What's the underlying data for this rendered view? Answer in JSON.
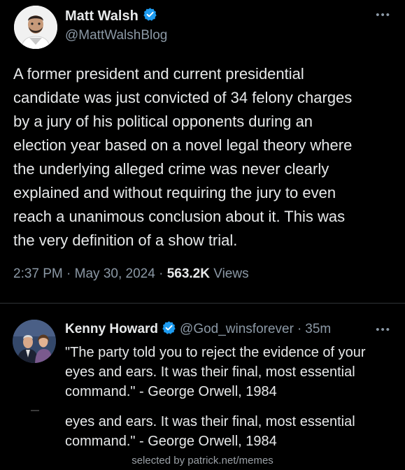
{
  "main_tweet": {
    "author_name": "Matt Walsh",
    "handle": "@MattWalshBlog",
    "text": "A former president and current presidential\ncandidate was just convicted of 34 felony charges\nby a jury of his political opponents during an\nelection year based on a novel legal theory where\nthe underlying alleged crime was never clearly\nexplained and without requiring the jury to even\nreach a unanimous conclusion about it. This was\nthe very definition of a show trial.",
    "time": "2:37 PM",
    "date": "May 30, 2024",
    "separator": "·",
    "views_count": "563.2K",
    "views_label": "Views",
    "verified_color": "#1d9bf0"
  },
  "reply": {
    "author_name": "Kenny Howard",
    "handle": "@God_winsforever",
    "separator": "·",
    "time_ago": "35m",
    "text": "\"The party told you to reject the evidence of your\neyes and ears. It was their final, most essential\ncommand.\" - George Orwell, 1984",
    "duplicate_text": "eyes and ears. It was their final, most essential\ncommand.\" - George Orwell, 1984"
  },
  "icons": {
    "more": "more-options-icon",
    "verified": "verified-badge-icon"
  },
  "watermark": "selected by patrick.net/memes",
  "colors": {
    "background": "#000000",
    "text_primary": "#e7e9ea",
    "text_secondary": "#8b98a5",
    "divider": "#2f3336"
  }
}
